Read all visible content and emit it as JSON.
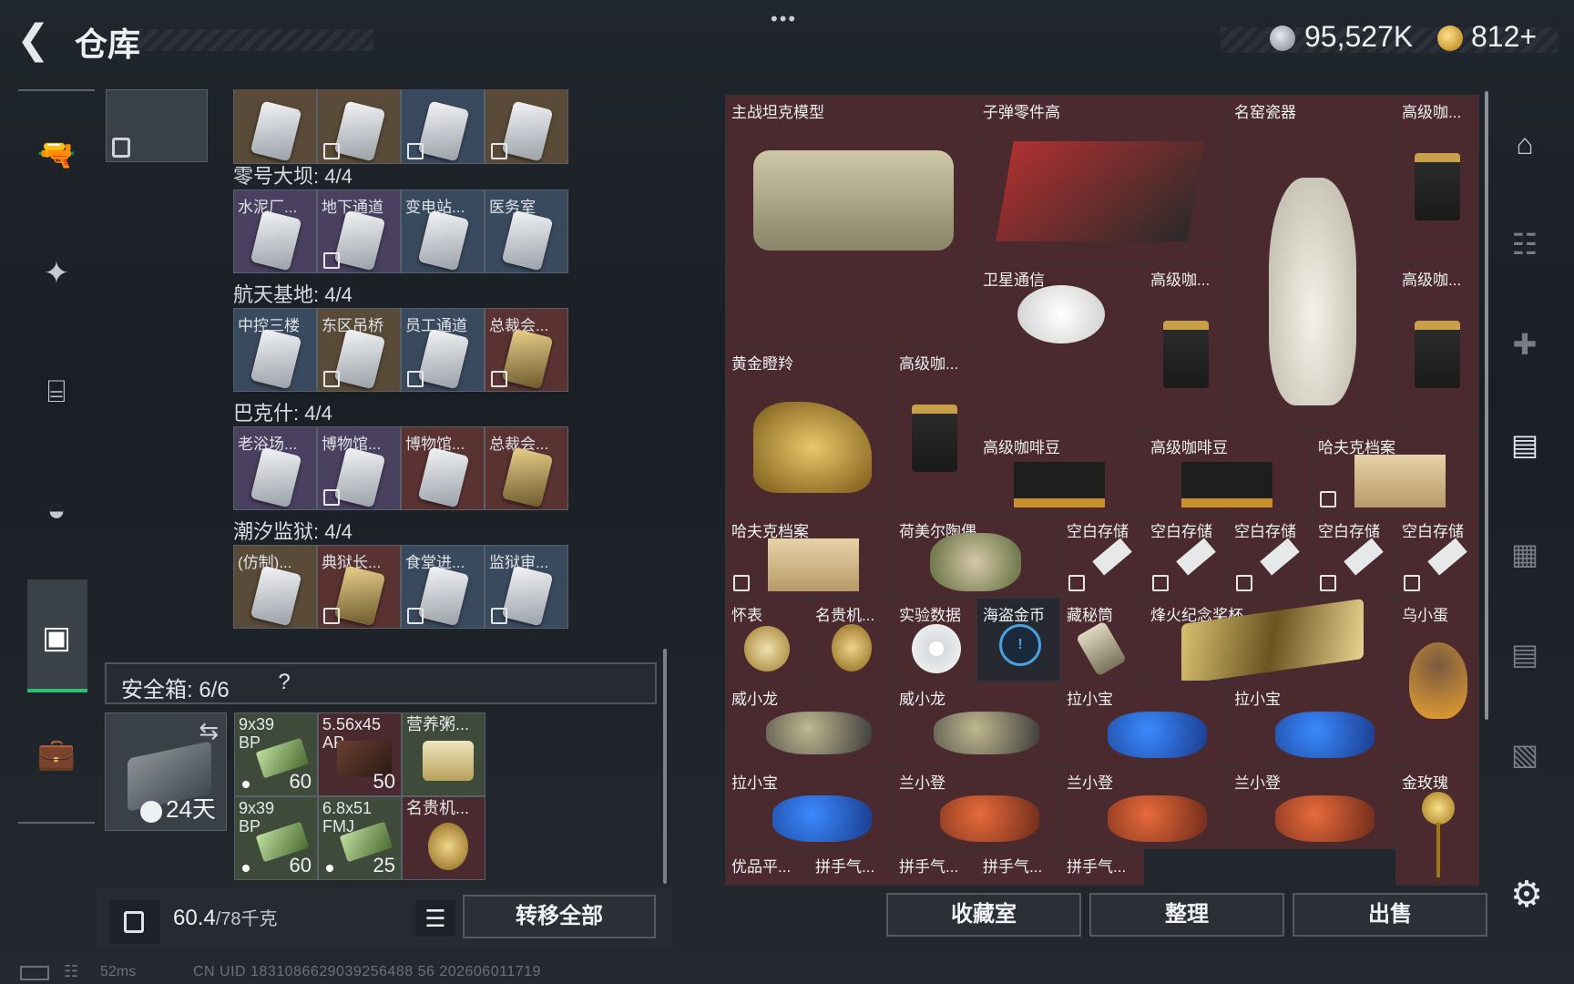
{
  "header": {
    "title": "仓库",
    "menu_dots": "•••",
    "currency_a": "95,527K",
    "currency_b": "812+"
  },
  "left": {
    "groups": [
      {
        "label": "零号大坝: 4/4",
        "keys": [
          "水泥厂...",
          "地下通道",
          "变电站...",
          "医务室"
        ]
      },
      {
        "label": "航天基地: 4/4",
        "keys": [
          "中控三楼",
          "东区吊桥",
          "员工通道",
          "总裁会..."
        ]
      },
      {
        "label": "巴克什: 4/4",
        "keys": [
          "老浴场...",
          "博物馆...",
          "博物馆...",
          "总裁会..."
        ]
      },
      {
        "label": "潮汐监狱: 4/4",
        "keys": [
          "(仿制)...",
          "典狱长...",
          "食堂进...",
          "监狱审..."
        ]
      }
    ],
    "safe_box": {
      "label": "安全箱: 6/6",
      "help": "?",
      "timer": "24天"
    },
    "safe_items": [
      {
        "name": "9x39\nBP",
        "count": "60"
      },
      {
        "name": "5.56x45\nAP",
        "count": "50"
      },
      {
        "name": "营养粥...",
        "count": ""
      },
      {
        "name": "9x39\nBP",
        "count": "60"
      },
      {
        "name": "6.8x51\nFMJ",
        "count": "25"
      },
      {
        "name": "名贵机...",
        "count": ""
      }
    ],
    "weight": "60.4",
    "weight_max": "/78千克",
    "transfer_all": "转移全部"
  },
  "right": {
    "items": [
      "主战坦克模型",
      "子弹零件高",
      "名窑瓷器",
      "高级咖...",
      "卫星通信",
      "高级咖...",
      "高级咖...",
      "黄金瞪羚",
      "高级咖...",
      "高级咖啡豆",
      "高级咖啡豆",
      "哈夫克档案",
      "哈夫克档案",
      "荷美尔陶偶",
      "空白存储",
      "空白存储",
      "空白存储",
      "空白存储",
      "空白存储",
      "怀表",
      "名贵机...",
      "实验数据",
      "海盗金币",
      "藏秘筒",
      "烽火纪念奖杯",
      "乌小蛋",
      "威小龙",
      "威小龙",
      "拉小宝",
      "拉小宝",
      "拉小宝",
      "兰小登",
      "兰小登",
      "兰小登",
      "金玫瑰",
      "优品平...",
      "拼手气...",
      "拼手气...",
      "拼手气...",
      "拼手气..."
    ],
    "buttons": {
      "collect": "收藏室",
      "sort": "整理",
      "sell": "出售"
    }
  },
  "status": {
    "latency": "52ms",
    "uid": "CN UID 1831086629039256488 56 202606011719"
  },
  "colors": {
    "accent_green": "#2fbf72",
    "item_bg": "#4a2a2e"
  }
}
